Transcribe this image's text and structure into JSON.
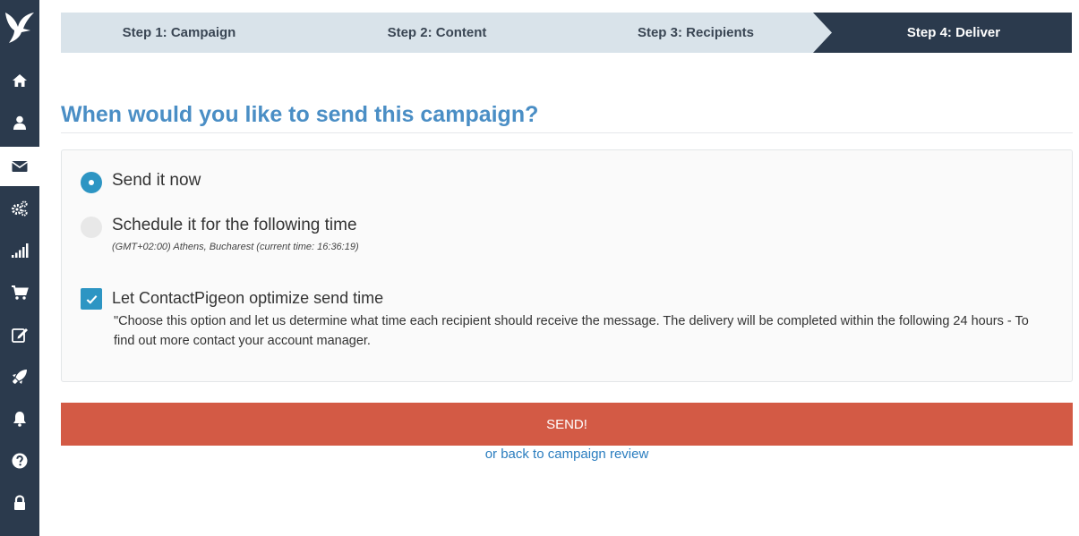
{
  "sidebar": {
    "items": [
      {
        "icon": "home-icon",
        "active": false
      },
      {
        "icon": "user-icon",
        "active": false
      },
      {
        "icon": "envelope-icon",
        "active": true
      },
      {
        "icon": "gears-icon",
        "active": false
      },
      {
        "icon": "signal-icon",
        "active": false
      },
      {
        "icon": "cart-icon",
        "active": false
      },
      {
        "icon": "edit-icon",
        "active": false
      },
      {
        "icon": "rocket-icon",
        "active": false
      },
      {
        "icon": "bell-icon",
        "active": false
      },
      {
        "icon": "help-icon",
        "active": false
      },
      {
        "icon": "lock-icon",
        "active": false
      }
    ]
  },
  "steps": [
    {
      "label": "Step 1: Campaign"
    },
    {
      "label": "Step 2: Content"
    },
    {
      "label": "Step 3: Recipients"
    },
    {
      "label": "Step 4: Deliver",
      "active": true
    }
  ],
  "heading": "When would you like to send this campaign?",
  "options": {
    "send_now": {
      "label": "Send it now",
      "selected": true
    },
    "schedule": {
      "label": "Schedule it for the following time",
      "selected": false,
      "timezone_note": "(GMT+02:00) Athens, Bucharest (current time: 16:36:19)"
    },
    "optimize": {
      "label": "Let ContactPigeon optimize send time",
      "checked": true,
      "description": "\"Choose this option and let us determine what time each recipient should receive the message. The delivery will be completed within the following 24 hours - To find out more contact your account manager."
    }
  },
  "send_button": "SEND!",
  "back_link": "or back to campaign review",
  "colors": {
    "sidebar": "#2b3a4d",
    "accent": "#2d95c3",
    "heading": "#4a8ec5",
    "send": "#d35a45",
    "link": "#2a7dbf"
  }
}
